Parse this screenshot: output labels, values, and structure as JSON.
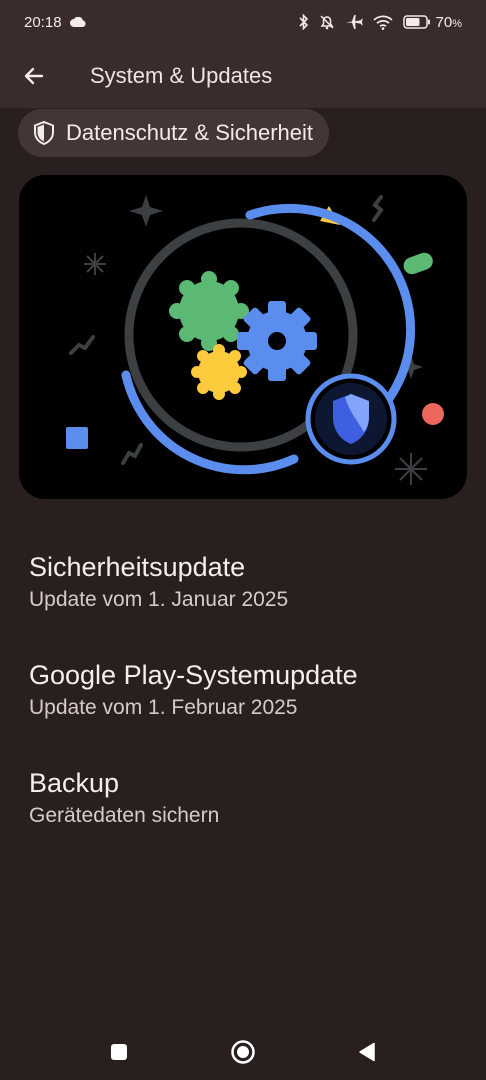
{
  "status_bar": {
    "time": "20:18",
    "battery_percent": "70",
    "battery_suffix": "%",
    "icons": [
      "cloud-icon",
      "bluetooth-icon",
      "bell-off-icon",
      "airplane-icon",
      "wifi-icon",
      "battery-icon"
    ]
  },
  "top_bar": {
    "title": "System & Updates",
    "back_icon": "arrow-left-icon"
  },
  "chip": {
    "label": "Datenschutz & Sicherheit",
    "icon": "shield-icon"
  },
  "hero": {
    "icons": [
      "settings-gear-icon",
      "security-shield-icon"
    ],
    "colors": {
      "ring": "#3c4043",
      "arc": "#5b8def",
      "green": "#5bb974",
      "yellow": "#fbcb3c",
      "red": "#ee675c",
      "shield": "#3f5fe3"
    }
  },
  "items": [
    {
      "title": "Sicherheitsupdate",
      "subtitle": "Update vom 1. Januar 2025"
    },
    {
      "title": "Google Play-Systemupdate",
      "subtitle": "Update vom 1. Februar 2025"
    },
    {
      "title": "Backup",
      "subtitle": "Gerätedaten sichern"
    }
  ],
  "nav_bar": {
    "icons": [
      "recents-square-icon",
      "home-circle-icon",
      "back-triangle-icon"
    ]
  },
  "colors": {
    "background": "#2a1f1f",
    "appbar": "#3a2c2b",
    "chip": "#433634"
  }
}
